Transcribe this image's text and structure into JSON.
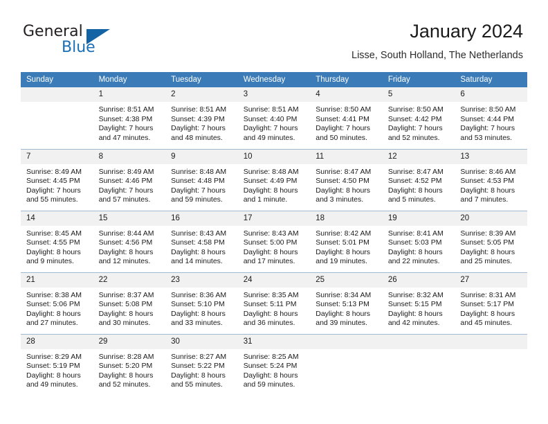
{
  "brand": {
    "name_part1": "General",
    "name_part2": "Blue",
    "accent_color": "#1464a5"
  },
  "header": {
    "title": "January 2024",
    "subtitle": "Lisse, South Holland, The Netherlands",
    "header_bg_color": "#3b7cb8"
  },
  "weekday_headers": [
    "Sunday",
    "Monday",
    "Tuesday",
    "Wednesday",
    "Thursday",
    "Friday",
    "Saturday"
  ],
  "weeks": [
    [
      {
        "day": "",
        "sunrise": "",
        "sunset": "",
        "daylight1": "",
        "daylight2": ""
      },
      {
        "day": "1",
        "sunrise": "Sunrise: 8:51 AM",
        "sunset": "Sunset: 4:38 PM",
        "daylight1": "Daylight: 7 hours",
        "daylight2": "and 47 minutes."
      },
      {
        "day": "2",
        "sunrise": "Sunrise: 8:51 AM",
        "sunset": "Sunset: 4:39 PM",
        "daylight1": "Daylight: 7 hours",
        "daylight2": "and 48 minutes."
      },
      {
        "day": "3",
        "sunrise": "Sunrise: 8:51 AM",
        "sunset": "Sunset: 4:40 PM",
        "daylight1": "Daylight: 7 hours",
        "daylight2": "and 49 minutes."
      },
      {
        "day": "4",
        "sunrise": "Sunrise: 8:50 AM",
        "sunset": "Sunset: 4:41 PM",
        "daylight1": "Daylight: 7 hours",
        "daylight2": "and 50 minutes."
      },
      {
        "day": "5",
        "sunrise": "Sunrise: 8:50 AM",
        "sunset": "Sunset: 4:42 PM",
        "daylight1": "Daylight: 7 hours",
        "daylight2": "and 52 minutes."
      },
      {
        "day": "6",
        "sunrise": "Sunrise: 8:50 AM",
        "sunset": "Sunset: 4:44 PM",
        "daylight1": "Daylight: 7 hours",
        "daylight2": "and 53 minutes."
      }
    ],
    [
      {
        "day": "7",
        "sunrise": "Sunrise: 8:49 AM",
        "sunset": "Sunset: 4:45 PM",
        "daylight1": "Daylight: 7 hours",
        "daylight2": "and 55 minutes."
      },
      {
        "day": "8",
        "sunrise": "Sunrise: 8:49 AM",
        "sunset": "Sunset: 4:46 PM",
        "daylight1": "Daylight: 7 hours",
        "daylight2": "and 57 minutes."
      },
      {
        "day": "9",
        "sunrise": "Sunrise: 8:48 AM",
        "sunset": "Sunset: 4:48 PM",
        "daylight1": "Daylight: 7 hours",
        "daylight2": "and 59 minutes."
      },
      {
        "day": "10",
        "sunrise": "Sunrise: 8:48 AM",
        "sunset": "Sunset: 4:49 PM",
        "daylight1": "Daylight: 8 hours",
        "daylight2": "and 1 minute."
      },
      {
        "day": "11",
        "sunrise": "Sunrise: 8:47 AM",
        "sunset": "Sunset: 4:50 PM",
        "daylight1": "Daylight: 8 hours",
        "daylight2": "and 3 minutes."
      },
      {
        "day": "12",
        "sunrise": "Sunrise: 8:47 AM",
        "sunset": "Sunset: 4:52 PM",
        "daylight1": "Daylight: 8 hours",
        "daylight2": "and 5 minutes."
      },
      {
        "day": "13",
        "sunrise": "Sunrise: 8:46 AM",
        "sunset": "Sunset: 4:53 PM",
        "daylight1": "Daylight: 8 hours",
        "daylight2": "and 7 minutes."
      }
    ],
    [
      {
        "day": "14",
        "sunrise": "Sunrise: 8:45 AM",
        "sunset": "Sunset: 4:55 PM",
        "daylight1": "Daylight: 8 hours",
        "daylight2": "and 9 minutes."
      },
      {
        "day": "15",
        "sunrise": "Sunrise: 8:44 AM",
        "sunset": "Sunset: 4:56 PM",
        "daylight1": "Daylight: 8 hours",
        "daylight2": "and 12 minutes."
      },
      {
        "day": "16",
        "sunrise": "Sunrise: 8:43 AM",
        "sunset": "Sunset: 4:58 PM",
        "daylight1": "Daylight: 8 hours",
        "daylight2": "and 14 minutes."
      },
      {
        "day": "17",
        "sunrise": "Sunrise: 8:43 AM",
        "sunset": "Sunset: 5:00 PM",
        "daylight1": "Daylight: 8 hours",
        "daylight2": "and 17 minutes."
      },
      {
        "day": "18",
        "sunrise": "Sunrise: 8:42 AM",
        "sunset": "Sunset: 5:01 PM",
        "daylight1": "Daylight: 8 hours",
        "daylight2": "and 19 minutes."
      },
      {
        "day": "19",
        "sunrise": "Sunrise: 8:41 AM",
        "sunset": "Sunset: 5:03 PM",
        "daylight1": "Daylight: 8 hours",
        "daylight2": "and 22 minutes."
      },
      {
        "day": "20",
        "sunrise": "Sunrise: 8:39 AM",
        "sunset": "Sunset: 5:05 PM",
        "daylight1": "Daylight: 8 hours",
        "daylight2": "and 25 minutes."
      }
    ],
    [
      {
        "day": "21",
        "sunrise": "Sunrise: 8:38 AM",
        "sunset": "Sunset: 5:06 PM",
        "daylight1": "Daylight: 8 hours",
        "daylight2": "and 27 minutes."
      },
      {
        "day": "22",
        "sunrise": "Sunrise: 8:37 AM",
        "sunset": "Sunset: 5:08 PM",
        "daylight1": "Daylight: 8 hours",
        "daylight2": "and 30 minutes."
      },
      {
        "day": "23",
        "sunrise": "Sunrise: 8:36 AM",
        "sunset": "Sunset: 5:10 PM",
        "daylight1": "Daylight: 8 hours",
        "daylight2": "and 33 minutes."
      },
      {
        "day": "24",
        "sunrise": "Sunrise: 8:35 AM",
        "sunset": "Sunset: 5:11 PM",
        "daylight1": "Daylight: 8 hours",
        "daylight2": "and 36 minutes."
      },
      {
        "day": "25",
        "sunrise": "Sunrise: 8:34 AM",
        "sunset": "Sunset: 5:13 PM",
        "daylight1": "Daylight: 8 hours",
        "daylight2": "and 39 minutes."
      },
      {
        "day": "26",
        "sunrise": "Sunrise: 8:32 AM",
        "sunset": "Sunset: 5:15 PM",
        "daylight1": "Daylight: 8 hours",
        "daylight2": "and 42 minutes."
      },
      {
        "day": "27",
        "sunrise": "Sunrise: 8:31 AM",
        "sunset": "Sunset: 5:17 PM",
        "daylight1": "Daylight: 8 hours",
        "daylight2": "and 45 minutes."
      }
    ],
    [
      {
        "day": "28",
        "sunrise": "Sunrise: 8:29 AM",
        "sunset": "Sunset: 5:19 PM",
        "daylight1": "Daylight: 8 hours",
        "daylight2": "and 49 minutes."
      },
      {
        "day": "29",
        "sunrise": "Sunrise: 8:28 AM",
        "sunset": "Sunset: 5:20 PM",
        "daylight1": "Daylight: 8 hours",
        "daylight2": "and 52 minutes."
      },
      {
        "day": "30",
        "sunrise": "Sunrise: 8:27 AM",
        "sunset": "Sunset: 5:22 PM",
        "daylight1": "Daylight: 8 hours",
        "daylight2": "and 55 minutes."
      },
      {
        "day": "31",
        "sunrise": "Sunrise: 8:25 AM",
        "sunset": "Sunset: 5:24 PM",
        "daylight1": "Daylight: 8 hours",
        "daylight2": "and 59 minutes."
      },
      {
        "day": "",
        "sunrise": "",
        "sunset": "",
        "daylight1": "",
        "daylight2": ""
      },
      {
        "day": "",
        "sunrise": "",
        "sunset": "",
        "daylight1": "",
        "daylight2": ""
      },
      {
        "day": "",
        "sunrise": "",
        "sunset": "",
        "daylight1": "",
        "daylight2": ""
      }
    ]
  ]
}
